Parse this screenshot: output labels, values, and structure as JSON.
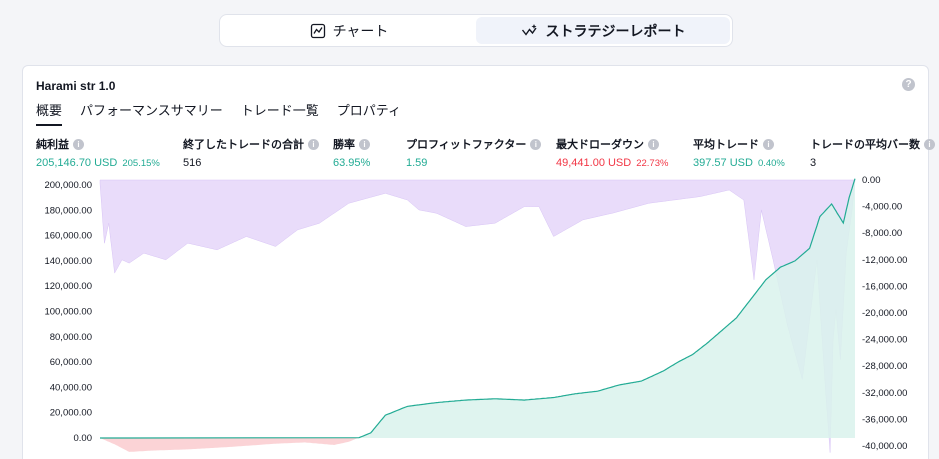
{
  "toggle": {
    "chart_label": "チャート",
    "report_label": "ストラテジーレポート",
    "active": "report"
  },
  "report": {
    "title": "Harami str 1.0",
    "tabs": [
      "概要",
      "パフォーマンスサマリー",
      "トレード一覧",
      "プロパティ"
    ],
    "active_tab": "概要"
  },
  "stats": [
    {
      "label": "純利益",
      "value": "205,146.70 USD",
      "sub": "205.15%",
      "color": "green"
    },
    {
      "label": "終了したトレードの合計",
      "value": "516",
      "sub": "",
      "color": "dark"
    },
    {
      "label": "勝率",
      "value": "63.95%",
      "sub": "",
      "color": "green"
    },
    {
      "label": "プロフィットファクター",
      "value": "1.59",
      "sub": "",
      "color": "green"
    },
    {
      "label": "最大ドローダウン",
      "value": "49,441.00 USD",
      "sub": "22.73%",
      "color": "red"
    },
    {
      "label": "平均トレード",
      "value": "397.57 USD",
      "sub": "0.40%",
      "color": "green"
    },
    {
      "label": "トレードの平均バー数",
      "value": "3",
      "sub": "",
      "color": "dark"
    }
  ],
  "colors": {
    "equity_line": "#22ab94",
    "equity_fill": "#d9f2ec",
    "loss_line": "#f23645",
    "loss_fill": "#fbd3d6",
    "drawdown_fill": "#e9dcfa",
    "drawdown_fill_strong": "#b8c6dd"
  },
  "chart_data": {
    "type": "area",
    "left_axis": {
      "ticks": [
        "200,000.00",
        "180,000.00",
        "160,000.00",
        "140,000.00",
        "120,000.00",
        "100,000.00",
        "80,000.00",
        "60,000.00",
        "40,000.00",
        "20,000.00",
        "0.00"
      ],
      "ylim": [
        -16000,
        205000
      ]
    },
    "right_axis": {
      "ticks": [
        "0.00",
        "-4,000.00",
        "-8,000.00",
        "-12,000.00",
        "-16,000.00",
        "-20,000.00",
        "-24,000.00",
        "-28,000.00",
        "-32,000.00",
        "-36,000.00",
        "-40,000.00"
      ],
      "ylim": [
        -41500,
        0
      ]
    },
    "series": [
      {
        "name": "",
        "axis": "left",
        "trade_index": [
          0,
          10,
          20,
          35,
          60,
          90,
          120,
          140,
          160,
          170,
          185,
          195,
          210,
          230,
          250,
          270,
          290,
          310,
          325,
          340,
          355,
          370,
          385,
          395,
          405,
          415,
          425,
          435,
          445,
          455,
          465,
          475,
          485,
          492,
          500,
          508,
          512,
          516
        ],
        "values": [
          0,
          -5000,
          -11000,
          -10000,
          -9000,
          -7000,
          -4500,
          -3500,
          -5500,
          -3000,
          4000,
          18000,
          25000,
          28000,
          30000,
          31000,
          30000,
          32000,
          35000,
          37000,
          42000,
          45000,
          53000,
          60000,
          66000,
          75000,
          85000,
          95000,
          110000,
          125000,
          135000,
          140000,
          150000,
          175000,
          185000,
          170000,
          190000,
          205000
        ]
      },
      {
        "name": "",
        "axis": "right",
        "trade_index": [
          0,
          3,
          6,
          10,
          15,
          20,
          30,
          45,
          60,
          80,
          100,
          120,
          135,
          150,
          170,
          195,
          210,
          218,
          230,
          250,
          270,
          290,
          300,
          310,
          330,
          350,
          375,
          410,
          430,
          440,
          447,
          452,
          460,
          470,
          480,
          490,
          496,
          499,
          501,
          503,
          506,
          510,
          514,
          516
        ],
        "values": [
          -500,
          -9500,
          -6500,
          -14000,
          -12000,
          -12500,
          -11000,
          -12000,
          -9500,
          -10500,
          -8500,
          -10000,
          -7500,
          -6500,
          -3500,
          -2000,
          -3000,
          -4500,
          -5000,
          -7000,
          -6500,
          -4000,
          -4000,
          -8500,
          -6000,
          -5000,
          -3500,
          -2500,
          -1500,
          -3000,
          -15000,
          -4500,
          -12000,
          -22000,
          -30000,
          -12000,
          -32000,
          -41000,
          -24000,
          -19500,
          -27000,
          -11000,
          -4500,
          0
        ]
      }
    ]
  }
}
